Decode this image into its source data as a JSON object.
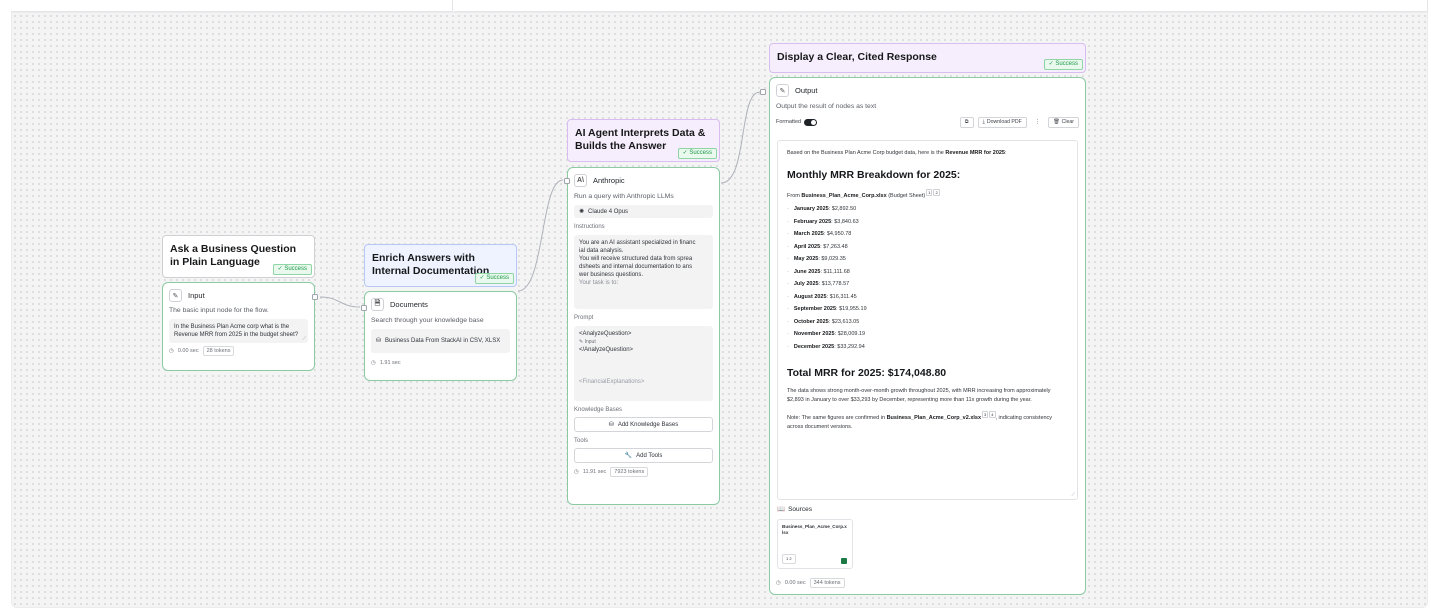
{
  "groups": {
    "g1": {
      "title": "Ask a Business Question in Plain Language",
      "status": "✓ Success"
    },
    "g2": {
      "title": "Enrich Answers with Internal Documentation",
      "status": "✓ Success"
    },
    "g3": {
      "title": "AI Agent Interprets Data & Builds the Answer",
      "status": "✓ Success"
    },
    "g4": {
      "title": "Display a Clear, Cited Response",
      "status": "✓ Success"
    }
  },
  "input_node": {
    "title": "Input",
    "description": "The basic input node for the flow.",
    "value": "In the Business Plan Acme corp what is the Revenue MRR from 2025 in the budget sheet?",
    "time": "0.00 sec",
    "tokens": "28 tokens"
  },
  "documents_node": {
    "title": "Documents",
    "description": "Search through your knowledge base",
    "source": "Business Data From StackAI in CSV, XLSX",
    "time": "1.91 sec"
  },
  "anthropic_node": {
    "title": "Anthropic",
    "description": "Run a query with Anthropic LLMs",
    "model": "Claude 4 Opus",
    "instructions_label": "Instructions",
    "instructions": [
      "You are an AI assistant specialized in financ",
      "ial data analysis.",
      "You will receive structured data from sprea",
      "dsheets and internal documentation to ans",
      "wer business questions.",
      "Your task is to:"
    ],
    "prompt_label": "Prompt",
    "prompt_open": "<AnalyzeQuestion>",
    "prompt_input": "Input",
    "prompt_close": "</AnalyzeQuestion>",
    "prompt_more": "<FinancialExplanations>",
    "kb_label": "Knowledge Bases",
    "kb_button": "Add Knowledge Bases",
    "tools_label": "Tools",
    "tools_button": "Add Tools",
    "time": "11.91 sec",
    "tokens": "7923 tokens"
  },
  "output_node": {
    "title": "Output",
    "description": "Output the result of nodes as text",
    "formatted_label": "Formatted",
    "download_label": "Download PDF",
    "more_label": "⋮",
    "clear_label": "Clear",
    "intro_plain": "Based on the Business Plan Acme Corp budget data, here is the ",
    "intro_bold": "Revenue MRR for 2025",
    "intro_end": ":",
    "breakdown_heading": "Monthly MRR Breakdown for 2025:",
    "from_prefix": "From ",
    "from_file": "Business_Plan_Acme_Corp.xlsx",
    "from_suffix": " (Budget Sheet)",
    "cite1": "1",
    "cite2": "2",
    "months": [
      {
        "month": "January 2025",
        "value": ": $2,892.50"
      },
      {
        "month": "February 2025",
        "value": ": $3,840.63"
      },
      {
        "month": "March 2025",
        "value": ": $4,950.78"
      },
      {
        "month": "April 2025",
        "value": ": $7,263.48"
      },
      {
        "month": "May 2025",
        "value": ": $9,029.35"
      },
      {
        "month": "June 2025",
        "value": ": $11,111.68"
      },
      {
        "month": "July 2025",
        "value": ": $13,778.57"
      },
      {
        "month": "August 2025",
        "value": ": $16,311.45"
      },
      {
        "month": "September 2025",
        "value": ": $19,955.19"
      },
      {
        "month": "October 2025",
        "value": ": $23,613.05"
      },
      {
        "month": "November 2025",
        "value": ": $28,009.19"
      },
      {
        "month": "December 2025",
        "value": ": $33,292.94"
      }
    ],
    "total_heading": "Total MRR for 2025: $174,048.80",
    "summary": "The data shows strong month-over-month growth throughout 2025, with MRR increasing from approximately $2,893 in January to over $33,293 by December, representing more than 11x growth during the year.",
    "note_prefix": "Note: The same figures are confirmed in ",
    "note_file": "Business_Plan_Acme_Corp_v2.xlsx",
    "cite3": "3",
    "cite4": "4",
    "note_suffix": ", indicating consistency across document versions.",
    "sources_label": "Sources",
    "source_file": "Business_Plan_Acme_Corp.xlsx",
    "source_refs": "1  2",
    "time": "0.00 sec",
    "tokens": "344 tokens"
  },
  "colors": {
    "success_border": "#8ccaa3",
    "success_text": "#1e9a4a",
    "blue_group": "#eef3ff",
    "purple_group": "#f6eefc"
  }
}
